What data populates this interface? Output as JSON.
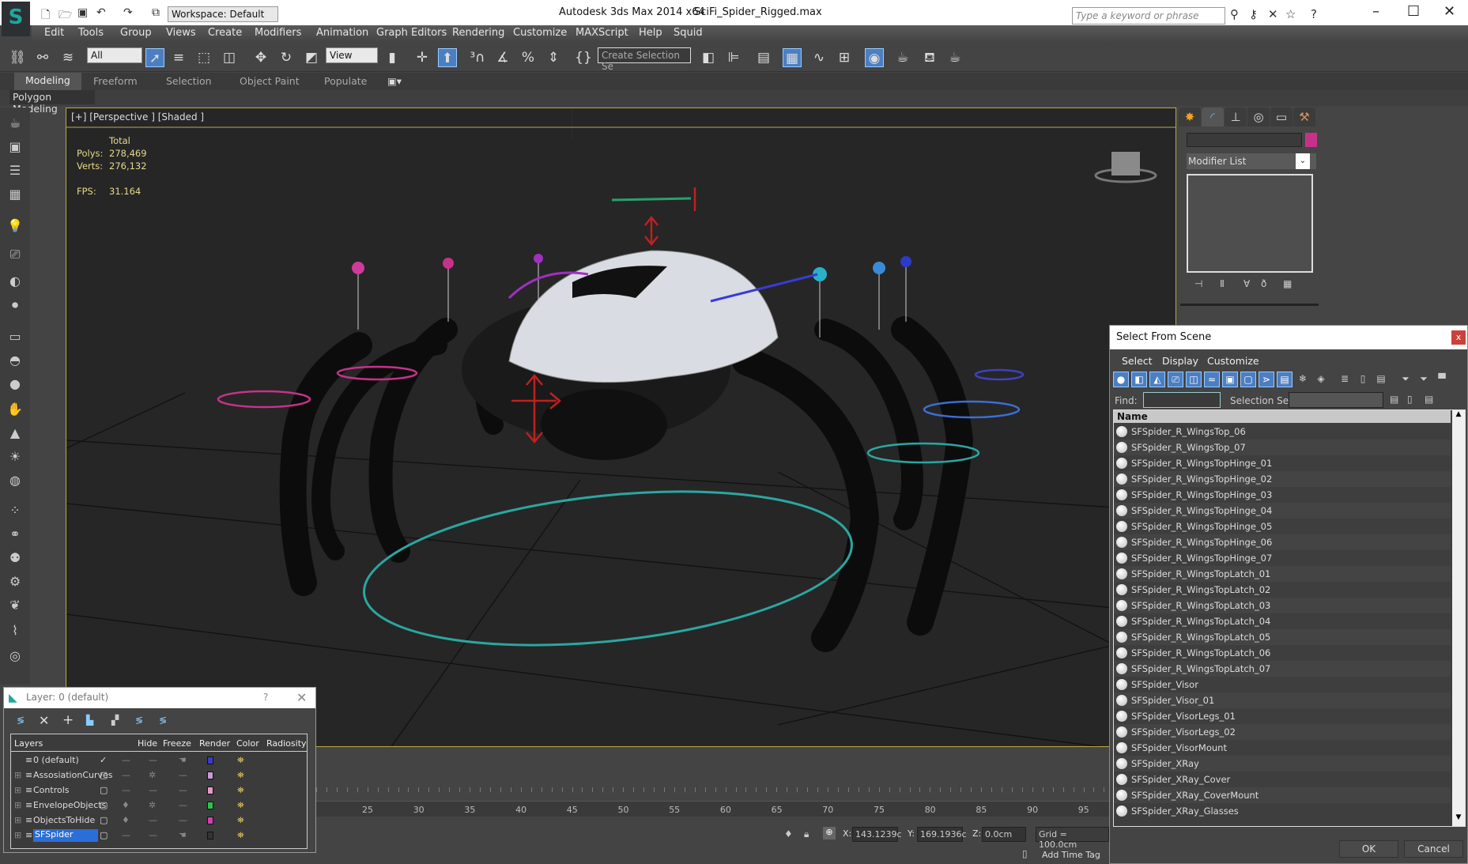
{
  "titlebar": {
    "app_title": "Autodesk 3ds Max  2014 x64",
    "file_title": "SciFi_Spider_Rigged.max",
    "workspace": "Workspace: Default",
    "search_placeholder": "Type a keyword or phrase"
  },
  "menu": [
    "Edit",
    "Tools",
    "Group",
    "Views",
    "Create",
    "Modifiers",
    "Animation",
    "Graph Editors",
    "Rendering",
    "Customize",
    "MAXScript",
    "Help",
    "Squid"
  ],
  "toolbar": {
    "filter": "All",
    "ref_coord": "View",
    "selection_set": "Create Selection Se"
  },
  "ribbon": {
    "tabs": [
      "Modeling",
      "Freeform",
      "Selection",
      "Object Paint",
      "Populate"
    ],
    "active": "Modeling",
    "panel": "Polygon Modeling"
  },
  "viewport": {
    "label": "[+] [Perspective ] [Shaded ]",
    "stats": {
      "header": "Total",
      "polys_label": "Polys:",
      "polys": "278,469",
      "verts_label": "Verts:",
      "verts": "276,132",
      "fps_label": "FPS:",
      "fps": "31.164"
    }
  },
  "command_panel": {
    "modifier_list": "Modifier List",
    "object_color": "#c8318a"
  },
  "timeline": {
    "ticks": [
      "25",
      "30",
      "35",
      "40",
      "45",
      "50",
      "55",
      "60",
      "65",
      "70",
      "75",
      "80",
      "85",
      "90",
      "95"
    ]
  },
  "status": {
    "x_label": "X:",
    "x": "143.1239c",
    "y_label": "Y:",
    "y": "169.1936c",
    "z_label": "Z:",
    "z": "0.0cm",
    "grid": "Grid = 100.0cm",
    "time_tag": "Add Time Tag"
  },
  "layer_dialog": {
    "title": "Layer: 0 (default)",
    "help": "?",
    "columns": [
      "Layers",
      "Hide",
      "Freeze",
      "Render",
      "Color",
      "Radiosity"
    ],
    "layers": [
      {
        "name": "0 (default)",
        "color": "#3a3ad0"
      },
      {
        "name": "AssosiationCurves",
        "color": "#c89ad8"
      },
      {
        "name": "Controls",
        "color": "#e49ac8"
      },
      {
        "name": "EnvelopeObjects",
        "color": "#2fbf4f"
      },
      {
        "name": "ObjectsToHide",
        "color": "#d040b0"
      },
      {
        "name": "SFSpider",
        "color": "#333333"
      }
    ]
  },
  "select_dialog": {
    "title": "Select From Scene",
    "close": "x",
    "menus": [
      "Select",
      "Display",
      "Customize"
    ],
    "find_label": "Find:",
    "selection_set_label": "Selection Set:",
    "column": "Name",
    "items": [
      "SFSpider_R_WingsTop_06",
      "SFSpider_R_WingsTop_07",
      "SFSpider_R_WingsTopHinge_01",
      "SFSpider_R_WingsTopHinge_02",
      "SFSpider_R_WingsTopHinge_03",
      "SFSpider_R_WingsTopHinge_04",
      "SFSpider_R_WingsTopHinge_05",
      "SFSpider_R_WingsTopHinge_06",
      "SFSpider_R_WingsTopHinge_07",
      "SFSpider_R_WingsTopLatch_01",
      "SFSpider_R_WingsTopLatch_02",
      "SFSpider_R_WingsTopLatch_03",
      "SFSpider_R_WingsTopLatch_04",
      "SFSpider_R_WingsTopLatch_05",
      "SFSpider_R_WingsTopLatch_06",
      "SFSpider_R_WingsTopLatch_07",
      "SFSpider_Visor",
      "SFSpider_Visor_01",
      "SFSpider_VisorLegs_01",
      "SFSpider_VisorLegs_02",
      "SFSpider_VisorMount",
      "SFSpider_XRay",
      "SFSpider_XRay_Cover",
      "SFSpider_XRay_CoverMount",
      "SFSpider_XRay_Glasses"
    ],
    "ok": "OK",
    "cancel": "Cancel"
  }
}
